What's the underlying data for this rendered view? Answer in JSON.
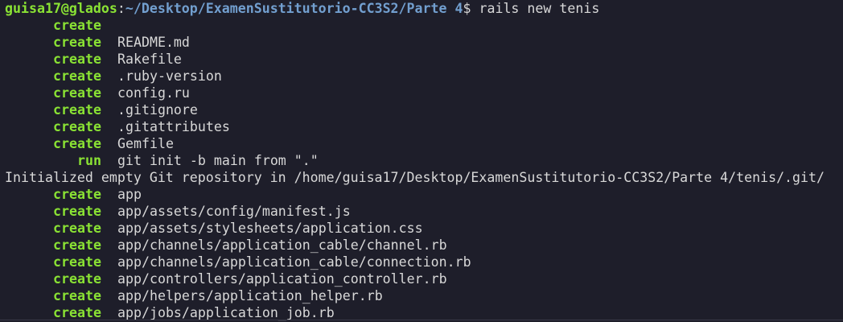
{
  "prompt": {
    "user_host": "guisa17@glados",
    "separator": ":",
    "path": "~/Desktop/ExamenSustitutorio-CC3S2/Parte 4",
    "dollar": "$",
    "command": "rails new tenis"
  },
  "output": [
    {
      "action": "create",
      "target": ""
    },
    {
      "action": "create",
      "target": "README.md"
    },
    {
      "action": "create",
      "target": "Rakefile"
    },
    {
      "action": "create",
      "target": ".ruby-version"
    },
    {
      "action": "create",
      "target": "config.ru"
    },
    {
      "action": "create",
      "target": ".gitignore"
    },
    {
      "action": "create",
      "target": ".gitattributes"
    },
    {
      "action": "create",
      "target": "Gemfile"
    },
    {
      "action": "run",
      "target": "git init -b main from \".\""
    }
  ],
  "git_message": "Initialized empty Git repository in /home/guisa17/Desktop/ExamenSustitutorio-CC3S2/Parte 4/tenis/.git/",
  "output2": [
    {
      "action": "create",
      "target": "app"
    },
    {
      "action": "create",
      "target": "app/assets/config/manifest.js"
    },
    {
      "action": "create",
      "target": "app/assets/stylesheets/application.css"
    },
    {
      "action": "create",
      "target": "app/channels/application_cable/channel.rb"
    },
    {
      "action": "create",
      "target": "app/channels/application_cable/connection.rb"
    },
    {
      "action": "create",
      "target": "app/controllers/application_controller.rb"
    },
    {
      "action": "create",
      "target": "app/helpers/application_helper.rb"
    },
    {
      "action": "create",
      "target": "app/jobs/application_job.rb"
    }
  ],
  "colors": {
    "background": "#1e1e2a",
    "prompt_user": "#8ae234",
    "prompt_path": "#729fcf",
    "action": "#8ae234",
    "text": "#d8d8d8"
  }
}
